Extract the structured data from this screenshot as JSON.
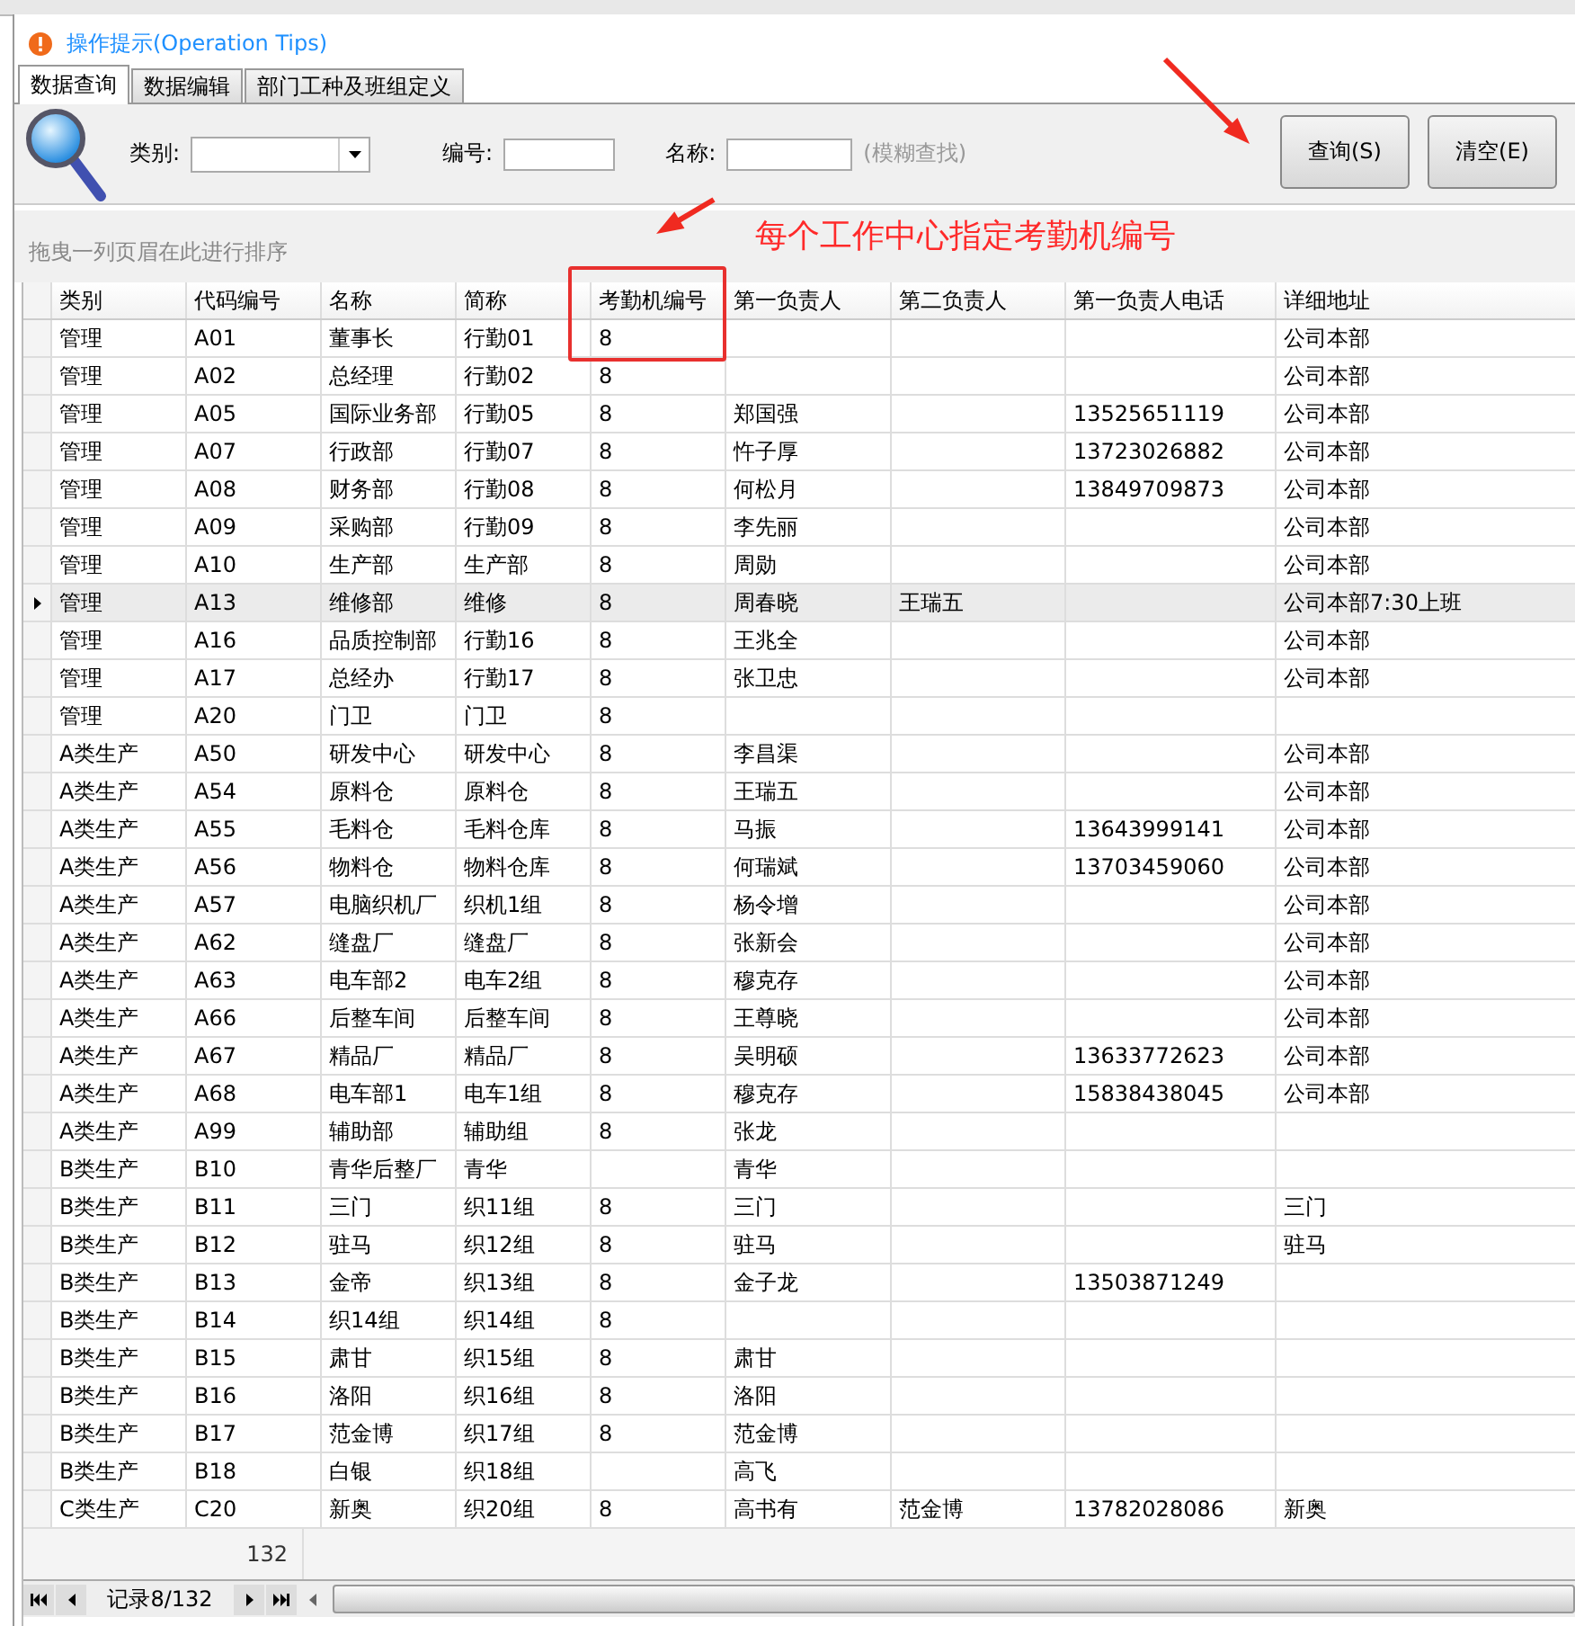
{
  "tips": {
    "title": "操作提示(Operation Tips)"
  },
  "tabs": [
    {
      "label": "数据查询",
      "selected": true
    },
    {
      "label": "数据编辑",
      "selected": false
    },
    {
      "label": "部门工种及班组定义",
      "selected": false
    }
  ],
  "filters": [
    {
      "label": "类别:",
      "kind": "dropdown"
    },
    {
      "label": "编号:",
      "kind": "text"
    },
    {
      "label": "名称:",
      "kind": "text",
      "hint": "(模糊查找)"
    }
  ],
  "buttons": [
    {
      "label": "查询(S)"
    },
    {
      "label": "清空(E)"
    }
  ],
  "group_hint": "拖曳一列页眉在此进行排序",
  "annotation": {
    "text": "每个工作中心指定考勤机编号"
  },
  "table": {
    "columns": [
      "类别",
      "代码编号",
      "名称",
      "简称",
      "考勤机编号",
      "第一负责人",
      "第二负责人",
      "第一负责人电话",
      "详细地址"
    ],
    "rows": [
      {
        "selected": false,
        "cells": [
          "管理",
          "A01",
          "董事长",
          "行勤01",
          "8",
          null,
          null,
          null,
          "公司本部"
        ]
      },
      {
        "selected": false,
        "cells": [
          "管理",
          "A02",
          "总经理",
          "行勤02",
          "8",
          null,
          null,
          null,
          "公司本部"
        ]
      },
      {
        "selected": false,
        "cells": [
          "管理",
          "A05",
          "国际业务部",
          "行勤05",
          "8",
          "郑国强",
          null,
          "13525651119",
          "公司本部"
        ]
      },
      {
        "selected": false,
        "cells": [
          "管理",
          "A07",
          "行政部",
          "行勤07",
          "8",
          "忤子厚",
          null,
          "13723026882",
          "公司本部"
        ]
      },
      {
        "selected": false,
        "cells": [
          "管理",
          "A08",
          "财务部",
          "行勤08",
          "8",
          "何松月",
          null,
          "13849709873",
          "公司本部"
        ]
      },
      {
        "selected": false,
        "cells": [
          "管理",
          "A09",
          "采购部",
          "行勤09",
          "8",
          "李先丽",
          null,
          null,
          "公司本部"
        ]
      },
      {
        "selected": false,
        "cells": [
          "管理",
          "A10",
          "生产部",
          "生产部",
          "8",
          "周勋",
          null,
          null,
          "公司本部"
        ]
      },
      {
        "selected": true,
        "cells": [
          "管理",
          "A13",
          "维修部",
          "维修",
          "8",
          "周春晓",
          "王瑞五",
          null,
          "公司本部7:30上班"
        ]
      },
      {
        "selected": false,
        "cells": [
          "管理",
          "A16",
          "品质控制部",
          "行勤16",
          "8",
          "王兆全",
          null,
          null,
          "公司本部"
        ]
      },
      {
        "selected": false,
        "cells": [
          "管理",
          "A17",
          "总经办",
          "行勤17",
          "8",
          "张卫忠",
          null,
          null,
          "公司本部"
        ]
      },
      {
        "selected": false,
        "cells": [
          "管理",
          "A20",
          "门卫",
          "门卫",
          "8",
          null,
          null,
          null,
          null
        ]
      },
      {
        "selected": false,
        "cells": [
          "A类生产",
          "A50",
          "研发中心",
          "研发中心",
          "8",
          "李昌渠",
          null,
          null,
          "公司本部"
        ]
      },
      {
        "selected": false,
        "cells": [
          "A类生产",
          "A54",
          "原料仓",
          "原料仓",
          "8",
          "王瑞五",
          null,
          null,
          "公司本部"
        ]
      },
      {
        "selected": false,
        "cells": [
          "A类生产",
          "A55",
          "毛料仓",
          "毛料仓库",
          "8",
          "马振",
          null,
          "13643999141",
          "公司本部"
        ]
      },
      {
        "selected": false,
        "cells": [
          "A类生产",
          "A56",
          "物料仓",
          "物料仓库",
          "8",
          "何瑞斌",
          null,
          "13703459060",
          "公司本部"
        ]
      },
      {
        "selected": false,
        "cells": [
          "A类生产",
          "A57",
          "电脑织机厂",
          "织机1组",
          "8",
          "杨令增",
          null,
          null,
          "公司本部"
        ]
      },
      {
        "selected": false,
        "cells": [
          "A类生产",
          "A62",
          "缝盘厂",
          "缝盘厂",
          "8",
          "张新会",
          null,
          null,
          "公司本部"
        ]
      },
      {
        "selected": false,
        "cells": [
          "A类生产",
          "A63",
          "电车部2",
          "电车2组",
          "8",
          "穆克存",
          null,
          null,
          "公司本部"
        ]
      },
      {
        "selected": false,
        "cells": [
          "A类生产",
          "A66",
          "后整车间",
          "后整车间",
          "8",
          "王尊晓",
          null,
          null,
          "公司本部"
        ]
      },
      {
        "selected": false,
        "cells": [
          "A类生产",
          "A67",
          "精品厂",
          "精品厂",
          "8",
          "吴明硕",
          null,
          "13633772623",
          "公司本部"
        ]
      },
      {
        "selected": false,
        "cells": [
          "A类生产",
          "A68",
          "电车部1",
          "电车1组",
          "8",
          "穆克存",
          null,
          "15838438045",
          "公司本部"
        ]
      },
      {
        "selected": false,
        "cells": [
          "A类生产",
          "A99",
          "辅助部",
          "辅助组",
          "8",
          "张龙",
          null,
          null,
          null
        ]
      },
      {
        "selected": false,
        "cells": [
          "B类生产",
          "B10",
          "青华后整厂",
          "青华",
          null,
          "青华",
          null,
          null,
          null
        ]
      },
      {
        "selected": false,
        "cells": [
          "B类生产",
          "B11",
          "三门",
          "织11组",
          "8",
          "三门",
          null,
          null,
          "三门"
        ]
      },
      {
        "selected": false,
        "cells": [
          "B类生产",
          "B12",
          "驻马",
          "织12组",
          "8",
          "驻马",
          null,
          null,
          "驻马"
        ]
      },
      {
        "selected": false,
        "cells": [
          "B类生产",
          "B13",
          "金帝",
          "织13组",
          "8",
          "金子龙",
          null,
          "13503871249",
          null
        ]
      },
      {
        "selected": false,
        "cells": [
          "B类生产",
          "B14",
          "织14组",
          "织14组",
          "8",
          null,
          null,
          null,
          null
        ]
      },
      {
        "selected": false,
        "cells": [
          "B类生产",
          "B15",
          "肃甘",
          "织15组",
          "8",
          "肃甘",
          null,
          null,
          null
        ]
      },
      {
        "selected": false,
        "cells": [
          "B类生产",
          "B16",
          "洛阳",
          "织16组",
          "8",
          "洛阳",
          null,
          null,
          null
        ]
      },
      {
        "selected": false,
        "cells": [
          "B类生产",
          "B17",
          "范金博",
          "织17组",
          "8",
          "范金博",
          null,
          null,
          null
        ]
      },
      {
        "selected": false,
        "cells": [
          "B类生产",
          "B18",
          "白银",
          "织18组",
          null,
          "高飞",
          null,
          null,
          null
        ]
      },
      {
        "selected": false,
        "cells": [
          "C类生产",
          "C20",
          "新奥",
          "织20组",
          "8",
          "高书有",
          "范金博",
          "13782028086",
          "新奥"
        ]
      }
    ],
    "footer_count": "132"
  },
  "navigator": {
    "record": "记录8/132"
  }
}
